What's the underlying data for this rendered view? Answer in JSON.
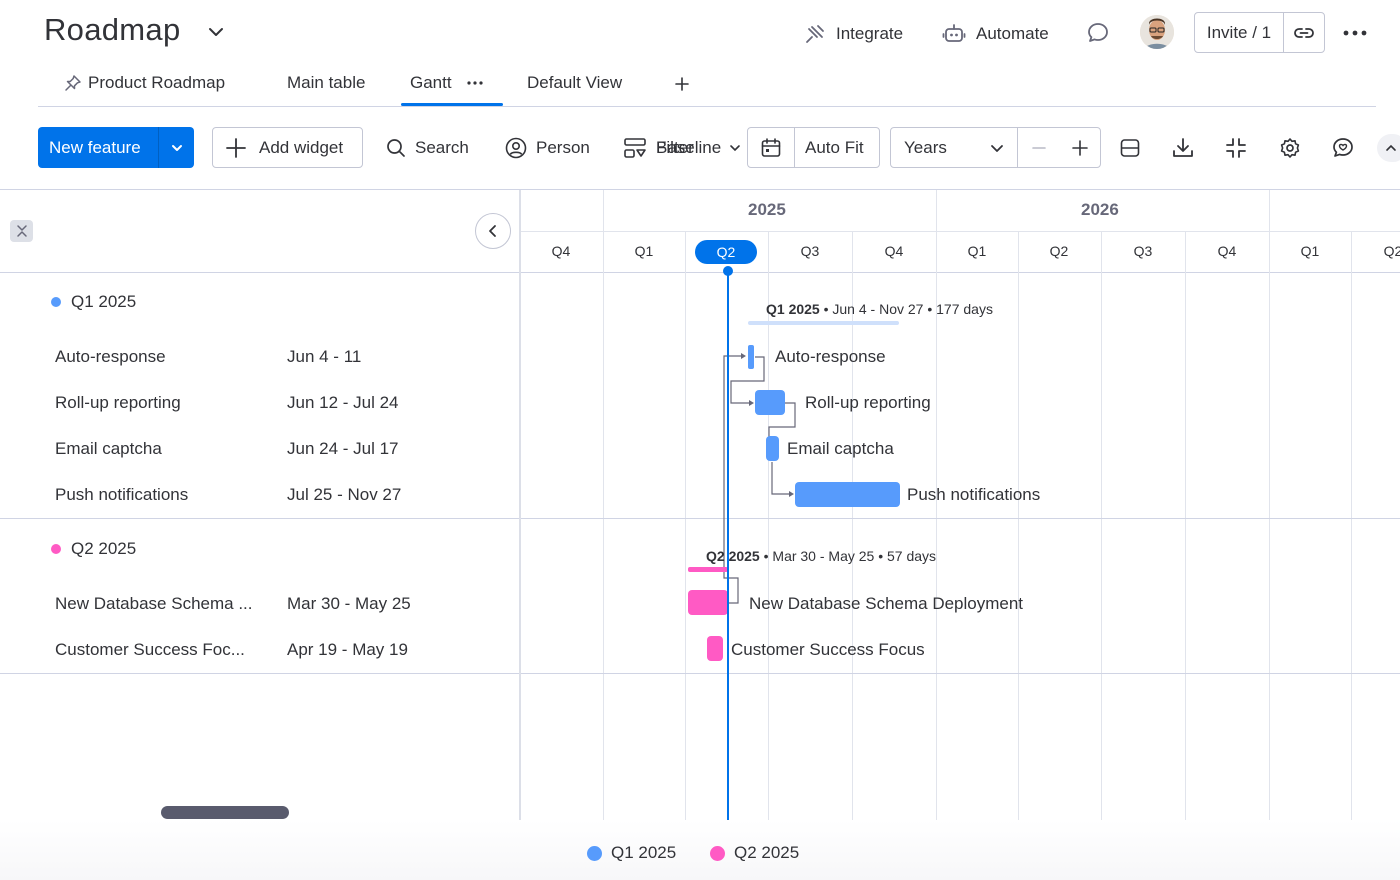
{
  "header": {
    "title": "Roadmap",
    "integrate_label": "Integrate",
    "automate_label": "Automate",
    "invite_label": "Invite / 1"
  },
  "tabs": [
    {
      "label": "Product Roadmap"
    },
    {
      "label": "Main table"
    },
    {
      "label": "Gantt",
      "active": true
    },
    {
      "label": "Default View"
    }
  ],
  "toolbar": {
    "new_item_label": "New feature",
    "add_widget_label": "Add widget",
    "search_label": "Search",
    "person_label": "Person",
    "filter_label": "Filter",
    "baseline_label": "Baseline",
    "auto_fit_label": "Auto Fit",
    "scale_value": "Years"
  },
  "timeline": {
    "years": [
      "2025",
      "2026"
    ],
    "quarters": [
      "Q4",
      "Q1",
      "Q2",
      "Q3",
      "Q4",
      "Q1",
      "Q2",
      "Q3",
      "Q4",
      "Q1",
      "Q2"
    ],
    "current_quarter": "Q2"
  },
  "groups": [
    {
      "name": "Q1 2025",
      "color": "#579bfc",
      "summary_name": "Q1 2025",
      "summary_detail": "• Jun 4 - Nov 27 • 177 days",
      "items": [
        {
          "name": "Auto-response",
          "dates": "Jun 4 - 11",
          "bar_label": "Auto-response"
        },
        {
          "name": "Roll-up reporting",
          "dates": "Jun 12 - Jul 24",
          "bar_label": "Roll-up reporting"
        },
        {
          "name": "Email captcha",
          "dates": "Jun 24 - Jul 17",
          "bar_label": "Email captcha"
        },
        {
          "name": "Push notifications",
          "dates": "Jul 25 - Nov 27",
          "bar_label": "Push notifications"
        }
      ]
    },
    {
      "name": "Q2 2025",
      "color": "#ff5ac4",
      "summary_name": "Q2 2025",
      "summary_detail": "• Mar 30 - May 25 • 57 days",
      "items": [
        {
          "name": "New Database Schema ...",
          "dates": "Mar 30 - May 25",
          "bar_label": "New Database Schema Deployment"
        },
        {
          "name": "Customer Success Foc...",
          "dates": "Apr 19 - May 19",
          "bar_label": "Customer Success Focus"
        }
      ]
    }
  ],
  "legend": [
    {
      "label": "Q1 2025",
      "color": "#579bfc"
    },
    {
      "label": "Q2 2025",
      "color": "#ff5ac4"
    }
  ]
}
